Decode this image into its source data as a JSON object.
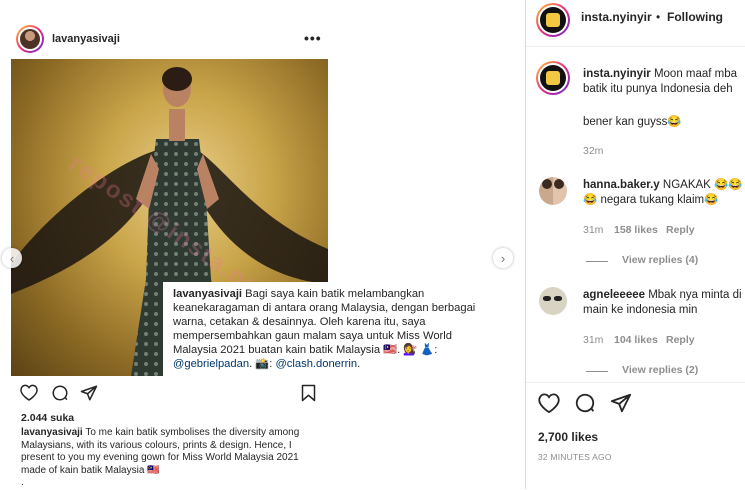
{
  "post": {
    "username": "lavanyasivaji",
    "likes": "2.044 suka",
    "caption_user": "lavanyasivaji",
    "caption_text": " To me kain batik symbolises the diversity among Malaysians, with its various colours, prints & design. Hence, I present to you my evening gown for Miss World Malaysia 2021 made of kain batik Malaysia 🇲🇾",
    "caption_more": "."
  },
  "overlay": {
    "username": "lavanyasivaji",
    "text": " Bagi saya kain batik melambangkan keanekaragaman di antara orang Malaysia, dengan berbagai warna, cetakan & desainnya. Oleh karena itu, saya mempersembahkan gaun malam saya untuk Miss World Malaysia 2021 buatan kain batik Malaysia 🇲🇾. 💇‍♀️ 👗: ",
    "mention1": "@gebrielpadan",
    "mid": ". 📸: ",
    "mention2": "@clash.donerrin",
    "end": "."
  },
  "watermark": "repost @insta.nyinyir",
  "right": {
    "header_user": "insta.nyinyir",
    "header_sep": "•",
    "following": "Following",
    "comments": [
      {
        "user": "insta.nyinyir",
        "text": " Moon maaf mba batik itu punya Indonesia deh",
        "text2": "bener kan guyss😂",
        "time": "32m"
      },
      {
        "user": "hanna.baker.y",
        "text": " NGAKAK 😂😂😂 negara tukang klaim😂",
        "time": "31m",
        "likes": "158 likes",
        "reply": "Reply",
        "view_replies": "View replies (4)"
      },
      {
        "user": "agneleeeee",
        "text": " Mbak nya minta di main ke indonesia min",
        "time": "31m",
        "likes": "104 likes",
        "reply": "Reply",
        "view_replies": "View replies (2)"
      }
    ],
    "likes": "2,700 likes",
    "time_ago": "32 MINUTES AGO"
  },
  "colors": {
    "link": "#00376b",
    "muted": "#8e8e8e",
    "border": "#dbdbdb"
  }
}
